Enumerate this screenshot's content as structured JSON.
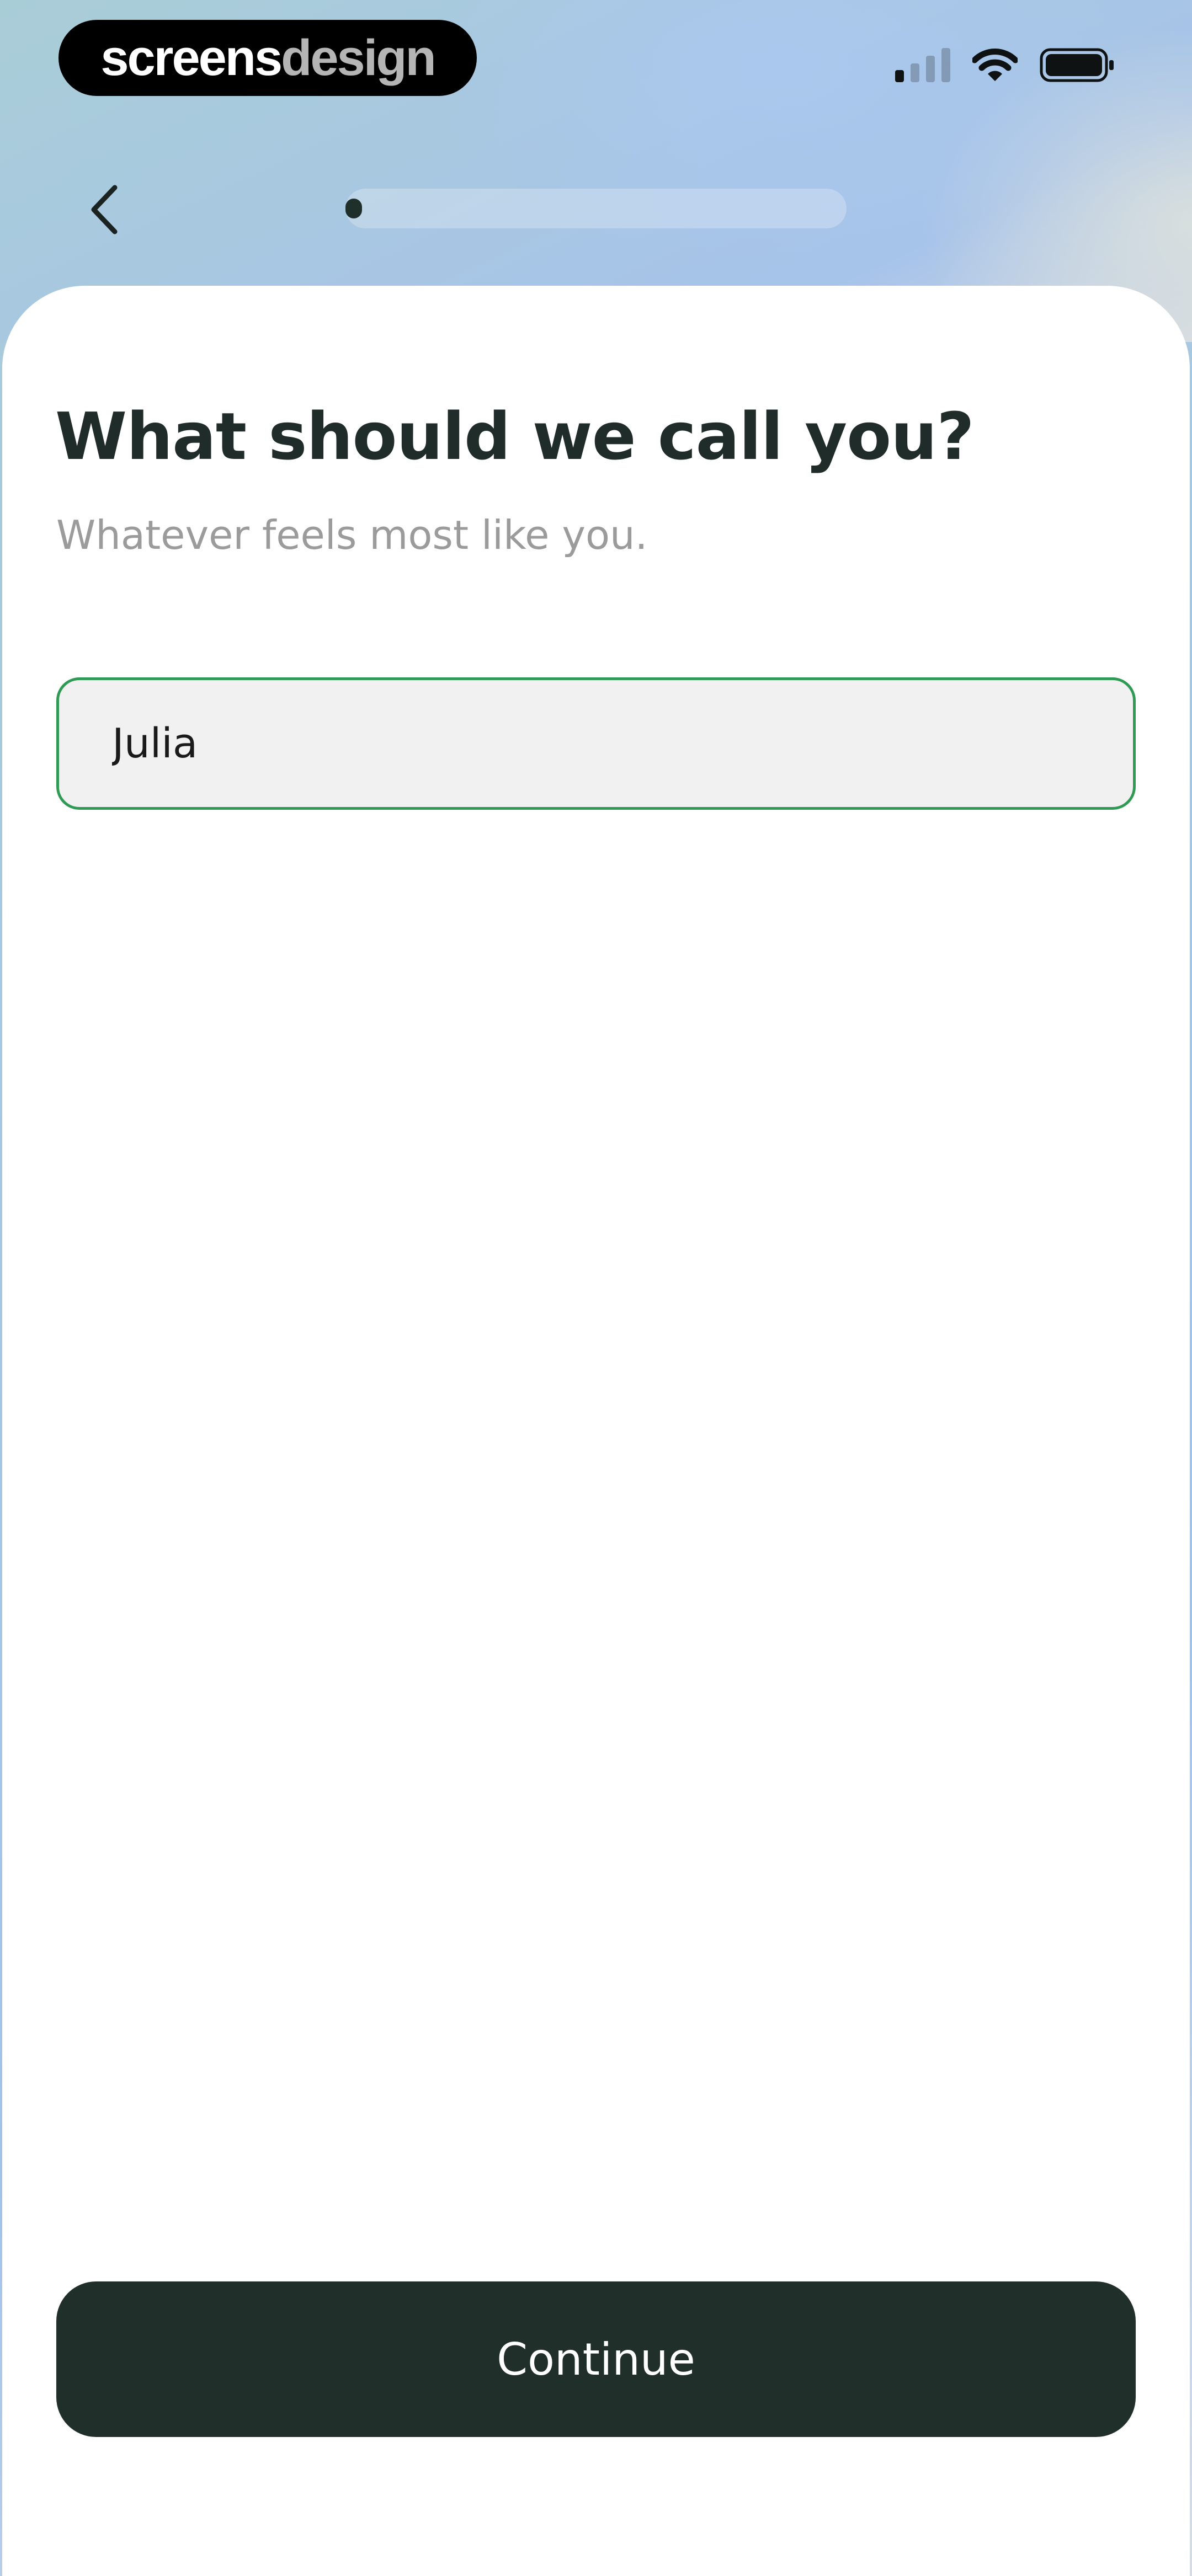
{
  "brand": {
    "part1": "screens",
    "part2": "design"
  },
  "status_bar": {
    "signal_icon": "cellular-signal-icon",
    "signal_bars_active": 1,
    "signal_bars_total": 4,
    "wifi_icon": "wifi-icon",
    "battery_icon": "battery-icon",
    "battery_level": 1.0
  },
  "nav": {
    "back_icon": "chevron-left-icon",
    "progress": 0.03
  },
  "main": {
    "title": "What should we call you?",
    "subtitle": "Whatever feels most like you.",
    "name_input": {
      "value": "Julia",
      "placeholder": ""
    }
  },
  "footer": {
    "continue_label": "Continue"
  },
  "colors": {
    "accent_green": "#2f9a53",
    "dark_green": "#202f2a",
    "title_text": "#1f2c29",
    "subtitle_text": "#9b9b9b",
    "input_bg": "#f1f1f1"
  }
}
